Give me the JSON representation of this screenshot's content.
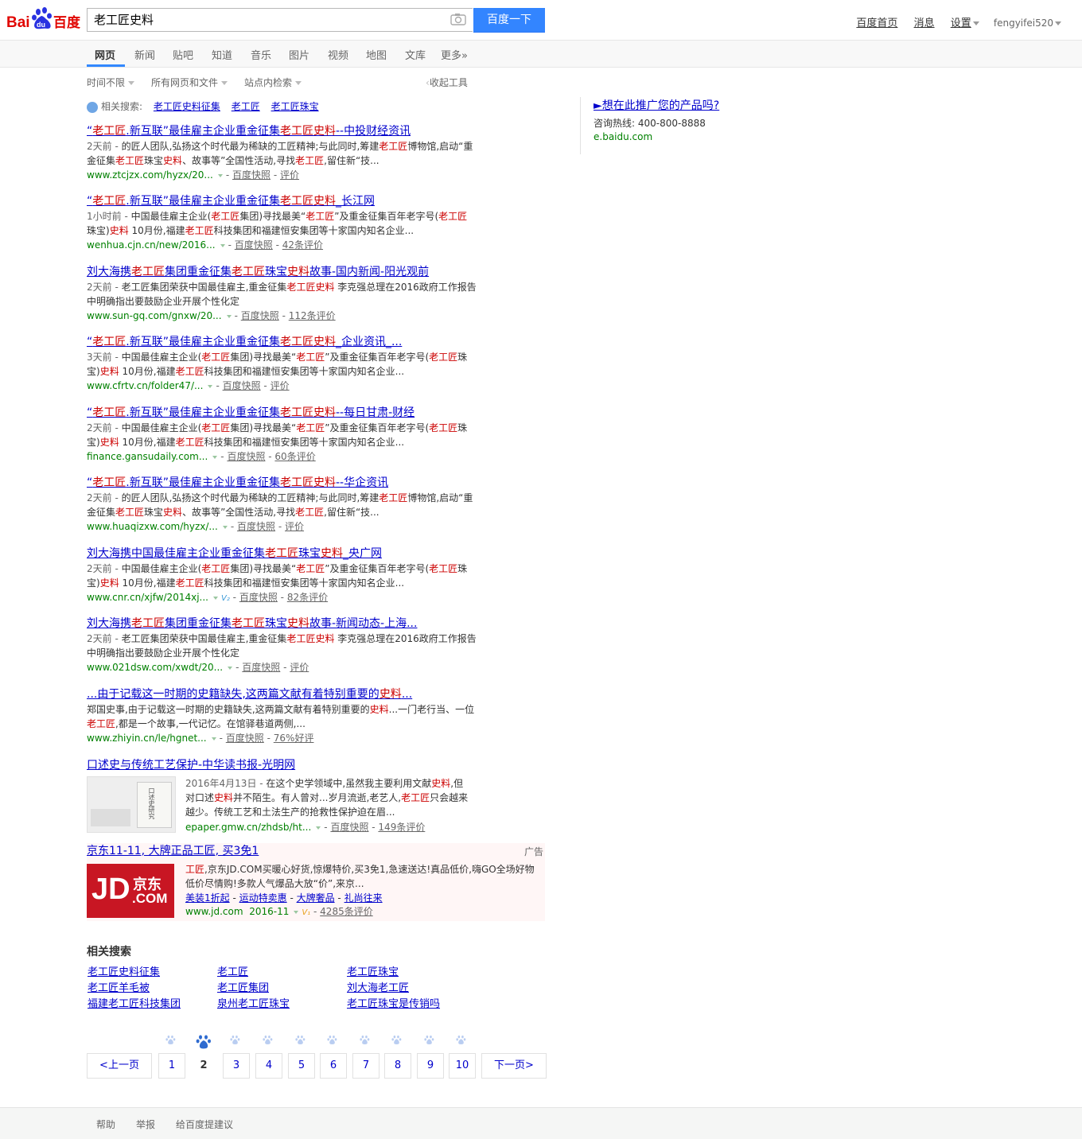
{
  "header": {
    "search_value": "老工匠史料",
    "search_button": "百度一下",
    "links": [
      "百度首页",
      "消息",
      "设置"
    ],
    "username": "fengyifei520"
  },
  "tabs": [
    "网页",
    "新闻",
    "贴吧",
    "知道",
    "音乐",
    "图片",
    "视频",
    "地图",
    "文库",
    "更多»"
  ],
  "tools": {
    "time": "时间不限",
    "filetype": "所有网页和文件",
    "site": "站点内检索",
    "collapse": "收起工具"
  },
  "related_top": {
    "label": "相关搜索:",
    "items": [
      "老工匠史料征集",
      "老工匠",
      "老工匠珠宝"
    ]
  },
  "results": [
    {
      "title": [
        "“",
        "老工匠",
        ".新互联”最佳雇主企业重金征集",
        "老工匠史料",
        "--中投财经资讯"
      ],
      "abstract": [
        [
          "2天前 - ",
          "d"
        ],
        [
          "的匠人团队,弘扬这个时代最为稀缺的工匠精神;与此同时,筹建",
          ""
        ],
        [
          "老工匠",
          "e"
        ],
        [
          "博物馆,启动“重金征集",
          ""
        ],
        [
          "老工匠",
          "e"
        ],
        [
          "珠宝",
          ""
        ],
        [
          "史料",
          "e"
        ],
        [
          "、故事等”全国性活动,寻找",
          ""
        ],
        [
          "老工匠",
          "e"
        ],
        [
          ",留住新“技...",
          ""
        ]
      ],
      "url": "www.ztcjzx.com/hyzx/20...",
      "snapshot": "百度快照",
      "comment": "评价"
    },
    {
      "title": [
        "“",
        "老工匠",
        ".新互联”最佳雇主企业重金征集",
        "老工匠史料",
        "_长江网"
      ],
      "abstract": [
        [
          "1小时前 - ",
          "d"
        ],
        [
          "中国最佳雇主企业(",
          ""
        ],
        [
          "老工匠",
          "e"
        ],
        [
          "集团)寻找最美“",
          ""
        ],
        [
          "老工匠",
          "e"
        ],
        [
          "”及重金征集百年老字号(",
          ""
        ],
        [
          "老工匠",
          "e"
        ],
        [
          "珠宝)",
          ""
        ],
        [
          "史料",
          "e"
        ],
        [
          " 10月份,福建",
          ""
        ],
        [
          "老工匠",
          "e"
        ],
        [
          "科技集团和福建恒安集团等十家国内知名企业...",
          ""
        ]
      ],
      "url": "wenhua.cjn.cn/new/2016...",
      "snapshot": "百度快照",
      "comment": "42条评价"
    },
    {
      "title": [
        "刘大海携",
        "老工匠",
        "集团重金征集",
        "老工匠",
        "珠宝",
        "史料",
        "故事-国内新闻-阳光观前"
      ],
      "abstract": [
        [
          "2天前 - ",
          "d"
        ],
        [
          "老工匠集团荣获中国最佳雇主,重金征集",
          ""
        ],
        [
          "老工匠史料",
          "e"
        ],
        [
          " 李克强总理在2016政府工作报告中明确指出要鼓励企业开展个性化定",
          ""
        ]
      ],
      "url": "www.sun-gq.com/gnxw/20...",
      "snapshot": "百度快照",
      "comment": "112条评价"
    },
    {
      "title": [
        "“",
        "老工匠",
        ".新互联”最佳雇主企业重金征集",
        "老工匠史料",
        "_企业资讯_..."
      ],
      "abstract": [
        [
          "3天前 - ",
          "d"
        ],
        [
          "中国最佳雇主企业(",
          ""
        ],
        [
          "老工匠",
          "e"
        ],
        [
          "集团)寻找最美“",
          ""
        ],
        [
          "老工匠",
          "e"
        ],
        [
          "”及重金征集百年老字号(",
          ""
        ],
        [
          "老工匠",
          "e"
        ],
        [
          "珠宝)",
          ""
        ],
        [
          "史料",
          "e"
        ],
        [
          " 10月份,福建",
          ""
        ],
        [
          "老工匠",
          "e"
        ],
        [
          "科技集团和福建恒安集团等十家国内知名企业...",
          ""
        ]
      ],
      "url": "www.cfrtv.cn/folder47/...",
      "snapshot": "百度快照",
      "comment": "评价"
    },
    {
      "title": [
        "“",
        "老工匠",
        ".新互联”最佳雇主企业重金征集",
        "老工匠史料",
        "--每日甘肃-财经"
      ],
      "abstract": [
        [
          "2天前 - ",
          "d"
        ],
        [
          "中国最佳雇主企业(",
          ""
        ],
        [
          "老工匠",
          "e"
        ],
        [
          "集团)寻找最美“",
          ""
        ],
        [
          "老工匠",
          "e"
        ],
        [
          "”及重金征集百年老字号(",
          ""
        ],
        [
          "老工匠",
          "e"
        ],
        [
          "珠宝)",
          ""
        ],
        [
          "史料",
          "e"
        ],
        [
          " 10月份,福建",
          ""
        ],
        [
          "老工匠",
          "e"
        ],
        [
          "科技集团和福建恒安集团等十家国内知名企业...",
          ""
        ]
      ],
      "url": "finance.gansudaily.com...",
      "snapshot": "百度快照",
      "comment": "60条评价"
    },
    {
      "title": [
        "“",
        "老工匠",
        ".新互联”最佳雇主企业重金征集",
        "老工匠史料",
        "--华企资讯"
      ],
      "abstract": [
        [
          "2天前 - ",
          "d"
        ],
        [
          "的匠人团队,弘扬这个时代最为稀缺的工匠精神;与此同时,筹建",
          ""
        ],
        [
          "老工匠",
          "e"
        ],
        [
          "博物馆,启动“重金征集",
          ""
        ],
        [
          "老工匠",
          "e"
        ],
        [
          "珠宝",
          ""
        ],
        [
          "史料",
          "e"
        ],
        [
          "、故事等”全国性活动,寻找",
          ""
        ],
        [
          "老工匠",
          "e"
        ],
        [
          ",留住新“技...",
          ""
        ]
      ],
      "url": "www.huaqizxw.com/hyzx/...",
      "snapshot": "百度快照",
      "comment": "评价"
    },
    {
      "title": [
        "刘大海携中国最佳雇主企业重金征集",
        "老工匠",
        "珠宝",
        "史料",
        "_央广网"
      ],
      "abstract": [
        [
          "2天前 - ",
          "d"
        ],
        [
          "中国最佳雇主企业(",
          ""
        ],
        [
          "老工匠",
          "e"
        ],
        [
          "集团)寻找最美“",
          ""
        ],
        [
          "老工匠",
          "e"
        ],
        [
          "”及重金征集百年老字号(",
          ""
        ],
        [
          "老工匠",
          "e"
        ],
        [
          "珠宝)",
          ""
        ],
        [
          "史料",
          "e"
        ],
        [
          " 10月份,福建",
          ""
        ],
        [
          "老工匠",
          "e"
        ],
        [
          "科技集团和福建恒安集团等十家国内知名企业...",
          ""
        ]
      ],
      "url": "www.cnr.cn/xjfw/2014xj...",
      "snapshot": "百度快照",
      "comment": "82条评价",
      "badge": "V2"
    },
    {
      "title": [
        "刘大海携",
        "老工匠",
        "集团重金征集",
        "老工匠",
        "珠宝",
        "史料",
        "故事-新闻动态-上海..."
      ],
      "abstract": [
        [
          "2天前 - ",
          "d"
        ],
        [
          "老工匠集团荣获中国最佳雇主,重金征集",
          ""
        ],
        [
          "老工匠史料",
          "e"
        ],
        [
          " 李克强总理在2016政府工作报告中明确指出要鼓励企业开展个性化定",
          ""
        ]
      ],
      "url": "www.021dsw.com/xwdt/20...",
      "snapshot": "百度快照",
      "comment": "评价"
    },
    {
      "title": [
        "...由于记载这一时期的史籍缺失,这两篇文献有着特别重要的",
        "史料",
        "..."
      ],
      "abstract": [
        [
          "郑国史事,由于记载这一时期的史籍缺失,这两篇文献有着特别重要的",
          ""
        ],
        [
          "史料",
          "e"
        ],
        [
          "...一门老行当、一位",
          ""
        ],
        [
          "老工匠",
          "e"
        ],
        [
          ",都是一个故事,一代记忆。在馆驿巷道两侧,...",
          ""
        ]
      ],
      "url": "www.zhiyin.cn/le/hgnet...",
      "snapshot": "百度快照",
      "comment": "76%好评"
    }
  ],
  "image_result": {
    "title": "口述史与传统工艺保护-中华读书报-光明网",
    "abstract": [
      [
        "2016年4月13日 - ",
        "d"
      ],
      [
        "在这个史学领域中,虽然我主要利用文献",
        ""
      ],
      [
        "史料",
        "e"
      ],
      [
        ",但对口述",
        ""
      ],
      [
        "史料",
        "e"
      ],
      [
        "并不陌生。有人曾对...岁月流逝,老艺人,",
        ""
      ],
      [
        "老工匠",
        "e"
      ],
      [
        "只会越来越少。传统工艺和土法生产的抢救性保护迫在眉...",
        ""
      ]
    ],
    "url": "epaper.gmw.cn/zhdsb/ht...",
    "snapshot": "百度快照",
    "comment": "149条评价",
    "book_text": "口述史研究"
  },
  "ad": {
    "title": "京东11-11, 大牌正品工匠, 买3免1",
    "label": "广告",
    "abstract_em": "工匠",
    "abstract": ",京东JD.COM买暖心好货,惊爆特价,买3免1,急速送达!真品低价,嗨GO全场好物低价尽情购!多款人气爆品大放“价”,来京...",
    "links": [
      "美装1折起",
      "运动特卖惠",
      "大牌奢品",
      "礼尚往来"
    ],
    "url": "www.jd.com",
    "date": "2016-11",
    "comment": "4285条评价",
    "logo_text": "JD",
    "logo_cn": "京东",
    "logo_com": ".COM"
  },
  "side_ad": {
    "title": "►想在此推广您的产品吗?",
    "hotline": "咨询热线: 400-800-8888",
    "url": "e.baidu.com"
  },
  "related_bottom": {
    "title": "相关搜索",
    "items": [
      "老工匠史料征集",
      "老工匠",
      "老工匠珠宝",
      "老工匠羊毛被",
      "老工匠集团",
      "刘大海老工匠",
      "福建老工匠科技集团",
      "泉州老工匠珠宝",
      "老工匠珠宝是传销吗"
    ]
  },
  "pager": {
    "prev": "<上一页",
    "pages": [
      "1",
      "2",
      "3",
      "4",
      "5",
      "6",
      "7",
      "8",
      "9",
      "10"
    ],
    "current": "2",
    "next": "下一页>"
  },
  "footer": [
    "帮助",
    "举报",
    "给百度提建议"
  ],
  "logo": {
    "bai": "Bai",
    "du": "du",
    "baidu_cn": "百度"
  },
  "colors": {
    "blue": "#3385ff",
    "link": "#0000cc",
    "em": "#cc0000",
    "url": "#008000"
  }
}
